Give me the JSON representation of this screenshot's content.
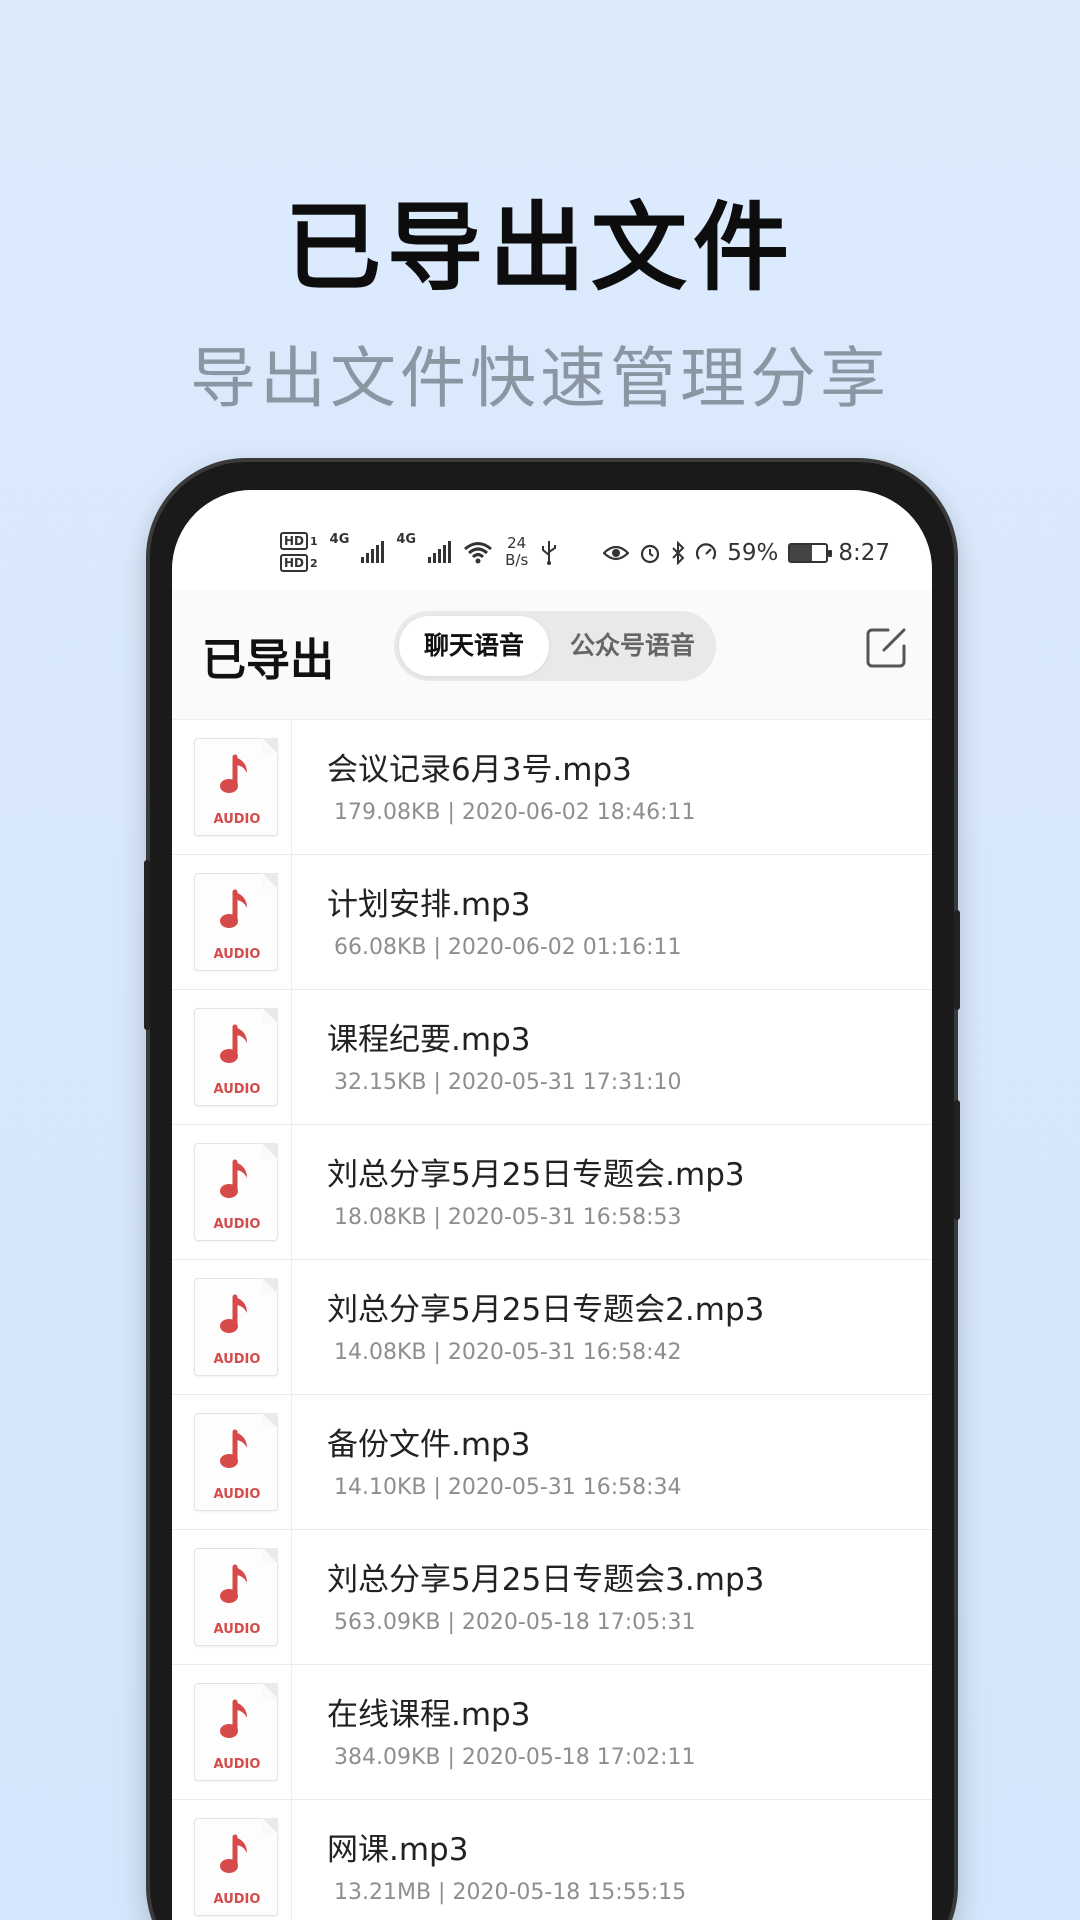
{
  "promo": {
    "title": "已导出文件",
    "subtitle": "导出文件快速管理分享"
  },
  "status_bar": {
    "hd_badge": "HD",
    "sim1": "1",
    "sim2": "2",
    "network_1": "4G",
    "network_2": "4G",
    "speed_value": "24",
    "speed_unit": "B/s",
    "battery": "59%",
    "battery_level": 0.59,
    "time": "8:27",
    "icons": [
      "eye-icon",
      "alarm-icon",
      "bluetooth-icon",
      "data-saver-icon",
      "usb-icon",
      "wifi-icon"
    ]
  },
  "header": {
    "title": "已导出",
    "tabs": [
      {
        "label": "聊天语音",
        "active": true
      },
      {
        "label": "公众号语音",
        "active": false
      }
    ],
    "edit_icon": "edit-icon"
  },
  "files": [
    {
      "name": "会议记录6月3号.mp3",
      "meta": "179.08KB | 2020-06-02 18:46:11",
      "type": "AUDIO"
    },
    {
      "name": "计划安排.mp3",
      "meta": "66.08KB | 2020-06-02 01:16:11",
      "type": "AUDIO"
    },
    {
      "name": "课程纪要.mp3",
      "meta": "32.15KB | 2020-05-31 17:31:10",
      "type": "AUDIO"
    },
    {
      "name": "刘总分享5月25日专题会.mp3",
      "meta": "18.08KB | 2020-05-31 16:58:53",
      "type": "AUDIO"
    },
    {
      "name": "刘总分享5月25日专题会2.mp3",
      "meta": "14.08KB | 2020-05-31 16:58:42",
      "type": "AUDIO"
    },
    {
      "name": "备份文件.mp3",
      "meta": "14.10KB | 2020-05-31 16:58:34",
      "type": "AUDIO"
    },
    {
      "name": "刘总分享5月25日专题会3.mp3",
      "meta": "563.09KB | 2020-05-18 17:05:31",
      "type": "AUDIO"
    },
    {
      "name": "在线课程.mp3",
      "meta": "384.09KB | 2020-05-18 17:02:11",
      "type": "AUDIO"
    },
    {
      "name": "网课.mp3",
      "meta": "13.21MB | 2020-05-18 15:55:15",
      "type": "AUDIO"
    }
  ],
  "colors": {
    "background": "#dceafc",
    "accent_red": "#d64a4a",
    "subtitle_gray": "#8a97a3"
  }
}
